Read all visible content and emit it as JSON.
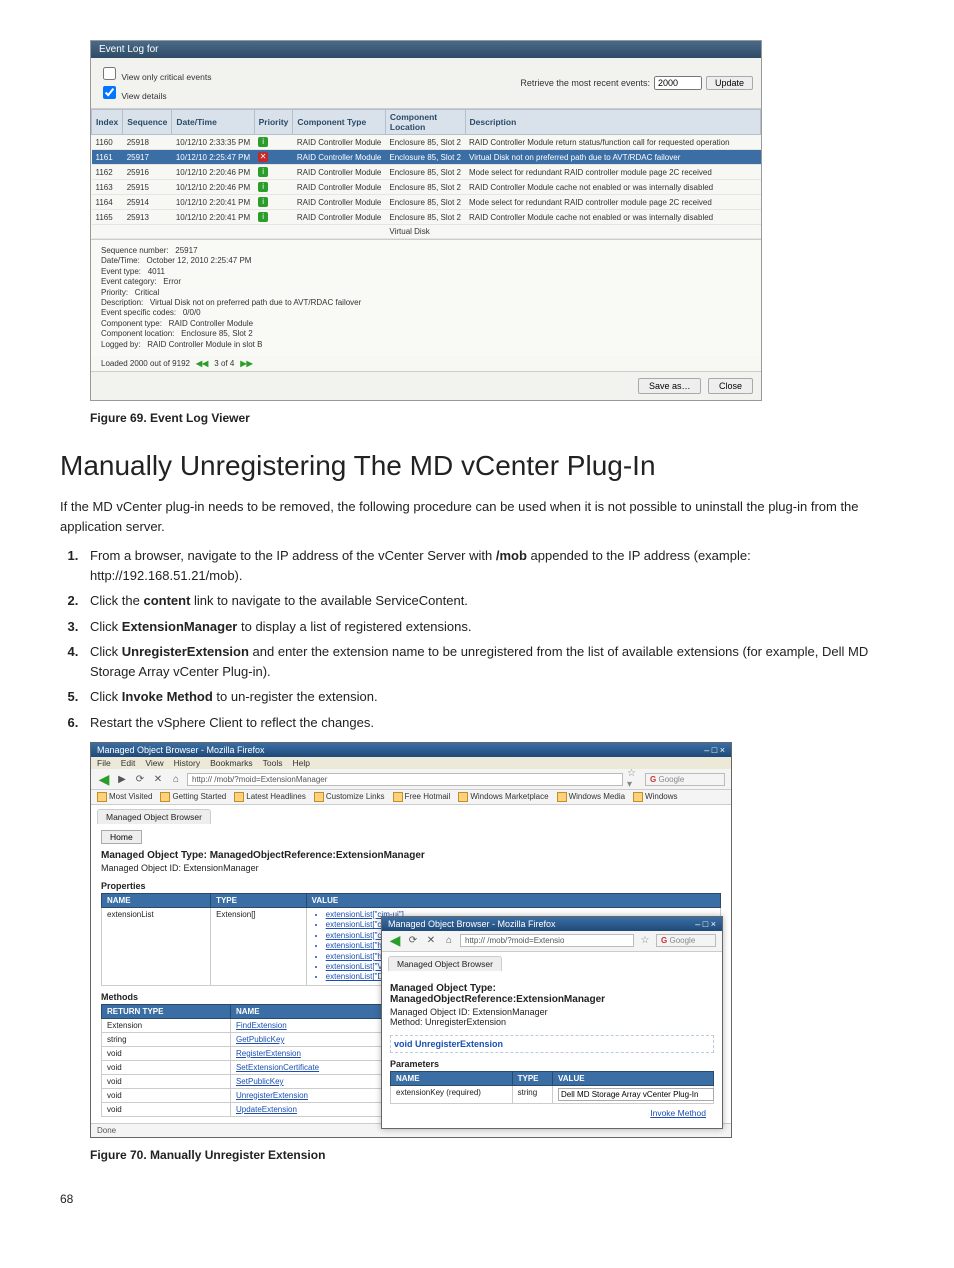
{
  "page_number": "68",
  "figure69": {
    "caption": "Figure 69. Event Log Viewer",
    "titlebar": "Event Log for",
    "view_critical_label": "View only critical events",
    "view_details_label": "View details",
    "retrieve_label": "Retrieve the most recent events:",
    "retrieve_value": "2000",
    "update_btn": "Update",
    "cols": [
      "Index",
      "Sequence",
      "Date/Time",
      "Priority",
      "Component Type",
      "Component Location",
      "Description"
    ],
    "rows": [
      {
        "index": "1160",
        "seq": "25918",
        "dt": "10/12/10 2:33:35 PM",
        "pri": "info",
        "ctype": "RAID Controller Module",
        "cloc": "Enclosure 85, Slot 2",
        "desc": "RAID Controller Module return status/function call for requested operation"
      },
      {
        "index": "1161",
        "seq": "25917",
        "dt": "10/12/10 2:25:47 PM",
        "pri": "crit",
        "ctype": "RAID Controller Module",
        "cloc": "Enclosure 85, Slot 2",
        "desc": "Virtual Disk not on preferred path due to AVT/RDAC failover",
        "sel": true
      },
      {
        "index": "1162",
        "seq": "25916",
        "dt": "10/12/10 2:20:46 PM",
        "pri": "info",
        "ctype": "RAID Controller Module",
        "cloc": "Enclosure 85, Slot 2",
        "desc": "Mode select for redundant RAID controller module page 2C received"
      },
      {
        "index": "1163",
        "seq": "25915",
        "dt": "10/12/10 2:20:46 PM",
        "pri": "info",
        "ctype": "RAID Controller Module",
        "cloc": "Enclosure 85, Slot 2",
        "desc": "RAID Controller Module cache not enabled or was internally disabled"
      },
      {
        "index": "1164",
        "seq": "25914",
        "dt": "10/12/10 2:20:41 PM",
        "pri": "info",
        "ctype": "RAID Controller Module",
        "cloc": "Enclosure 85, Slot 2",
        "desc": "Mode select for redundant RAID controller module page 2C received"
      },
      {
        "index": "1165",
        "seq": "25913",
        "dt": "10/12/10 2:20:41 PM",
        "pri": "info",
        "ctype": "RAID Controller Module",
        "cloc": "Enclosure 85, Slot 2",
        "desc": "RAID Controller Module cache not enabled or was internally disabled"
      },
      {
        "index": "",
        "seq": "",
        "dt": "",
        "pri": "",
        "ctype": "",
        "cloc": "Virtual Disk",
        "desc": ""
      }
    ],
    "details": {
      "seq_lbl": "Sequence number:",
      "seq_val": "25917",
      "dt_lbl": "Date/Time:",
      "dt_val": "October 12, 2010 2:25:47 PM",
      "etype_lbl": "Event type:",
      "etype_val": "4011",
      "ecat_lbl": "Event category:",
      "ecat_val": "Error",
      "prio_lbl": "Priority:",
      "prio_val": "Critical",
      "desc_lbl": "Description:",
      "desc_val": "Virtual Disk not on preferred path due to AVT/RDAC failover",
      "esc_lbl": "Event specific codes:",
      "esc_val": "0/0/0",
      "ctype_lbl": "Component type:",
      "ctype_val": "RAID Controller Module",
      "cloc_lbl": "Component location:",
      "cloc_val": "Enclosure 85, Slot 2",
      "log_lbl": "Logged by:",
      "log_val": "RAID Controller Module in slot B"
    },
    "loaded": "Loaded 2000 out of 9192",
    "page_of": "3 of 4",
    "saveas": "Save as…",
    "close": "Close"
  },
  "section": {
    "title": "Manually Unregistering The MD vCenter Plug-In",
    "intro": "If the MD vCenter plug-in needs to be removed, the following procedure can be used when it is not possible to uninstall the plug-in from the application server.",
    "steps": {
      "s1a": "From a browser, navigate to the IP address of the vCenter Server with ",
      "s1_mob": "/mob",
      "s1b": " appended to the IP address (example: http://192.168.51.21/mob).",
      "s2a": "Click the ",
      "s2_content": "content",
      "s2b": " link to navigate to the available ServiceContent.",
      "s3a": "Click ",
      "s3_em": "ExtensionManager",
      "s3b": " to display a list of registered extensions.",
      "s4a": "Click ",
      "s4_ue": "UnregisterExtension",
      "s4b": " and enter the extension name to be unregistered from the list of available extensions (for example, Dell MD Storage Array vCenter Plug-in).",
      "s5a": "Click ",
      "s5_im": "Invoke Method",
      "s5b": " to un-register the extension.",
      "s6": "Restart the vSphere Client to reflect the changes."
    }
  },
  "figure70": {
    "caption": "Figure 70. Manually Unregister Extension",
    "win_title": "Managed Object Browser - Mozilla Firefox",
    "menu": [
      "File",
      "Edit",
      "View",
      "History",
      "Bookmarks",
      "Tools",
      "Help"
    ],
    "url": "http://         /mob/?moid=ExtensionManager",
    "search_placeholder": "Google",
    "bookmarks": [
      "Most Visited",
      "Getting Started",
      "Latest Headlines",
      "Customize Links",
      "Free Hotmail",
      "Windows Marketplace",
      "Windows Media",
      "Windows"
    ],
    "tab_label": "Managed Object Browser",
    "home_btn": "Home",
    "h_line1": "Managed Object Type: ManagedObjectReference:ExtensionManager",
    "h_line2": "Managed Object ID: ExtensionManager",
    "props_h": "Properties",
    "props_cols": [
      "NAME",
      "TYPE",
      "VALUE"
    ],
    "prop_name": "extensionList",
    "prop_type": "Extension[]",
    "ext_list": [
      "extensionList[\"cim-ui\"]",
      "extensionList[\"com.vmware.vim.sms\"]",
      "extensionList[\"com.vmware.vim.stats.report\"]",
      "extensionList[\"health-ui\"]",
      "extensionList[\"hostdiag\"]",
      "extensionList[\"VirtualCenter\"]",
      "extensionList[\"Dell MD Storage Array vCenter Plug-In\"]"
    ],
    "methods_h": "Methods",
    "methods_cols": [
      "RETURN TYPE",
      "NAME"
    ],
    "methods": [
      {
        "rt": "Extension",
        "nm": "FindExtension"
      },
      {
        "rt": "string",
        "nm": "GetPublicKey"
      },
      {
        "rt": "void",
        "nm": "RegisterExtension"
      },
      {
        "rt": "void",
        "nm": "SetExtensionCertificate"
      },
      {
        "rt": "void",
        "nm": "SetPublicKey"
      },
      {
        "rt": "void",
        "nm": "UnregisterExtension"
      },
      {
        "rt": "void",
        "nm": "UpdateExtension"
      }
    ],
    "done": "Done",
    "overlay": {
      "win_title": "Managed Object Browser - Mozilla Firefox",
      "url": "http://         /mob/?moid=Extensio",
      "tab_label": "Managed Object Browser",
      "h1": "Managed Object Type:",
      "h2": "ManagedObjectReference:ExtensionManager",
      "h3": "Managed Object ID: ExtensionManager",
      "h4": "Method: UnregisterExtension",
      "void_line": "void UnregisterExtension",
      "params_h": "Parameters",
      "param_cols": [
        "NAME",
        "TYPE",
        "VALUE"
      ],
      "param_name": "extensionKey (required)",
      "param_type": "string",
      "param_value": "Dell MD Storage Array vCenter Plug-In",
      "invoke": "Invoke Method"
    }
  }
}
